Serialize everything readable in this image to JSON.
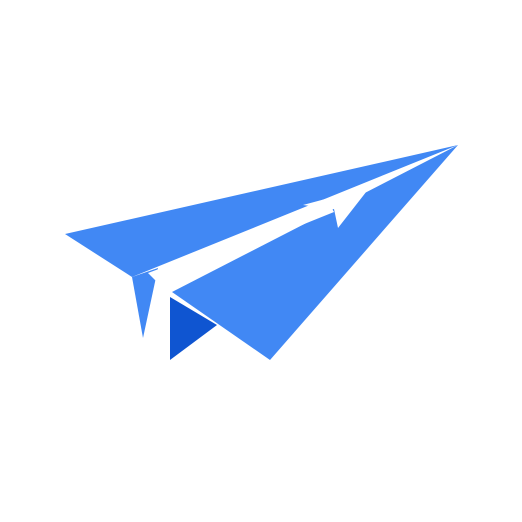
{
  "app": {
    "background_color": "#ffffff"
  },
  "logo": {
    "icon": "paper-plane-icon",
    "colors": {
      "primary": "#4188F4",
      "shadow": "#0F55D1",
      "arrow": "#ffffff"
    }
  }
}
